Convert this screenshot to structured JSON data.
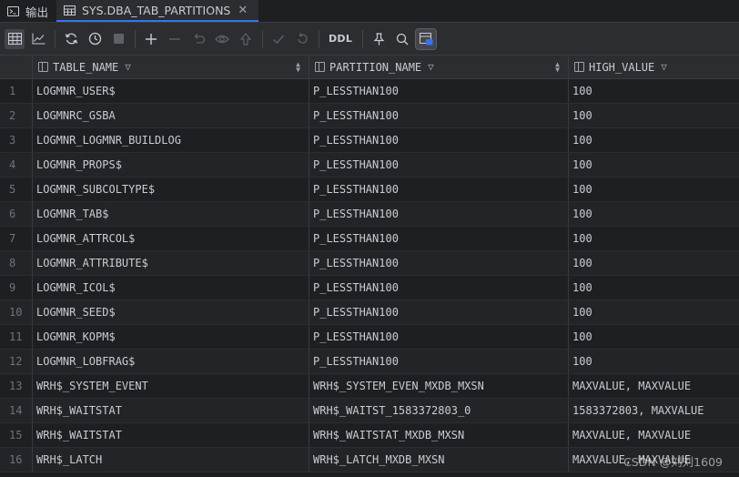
{
  "tabs": [
    {
      "label": "输出",
      "icon": "console-icon"
    },
    {
      "label": "SYS.DBA_TAB_PARTITIONS",
      "icon": "table-icon"
    }
  ],
  "toolbar": {
    "ddl_label": "DDL"
  },
  "columns": [
    "TABLE_NAME",
    "PARTITION_NAME",
    "HIGH_VALUE"
  ],
  "rows": [
    {
      "n": "1",
      "table_name": "LOGMNR_USER$",
      "partition_name": "P_LESSTHAN100",
      "high_value": "100"
    },
    {
      "n": "2",
      "table_name": "LOGMNRC_GSBA",
      "partition_name": "P_LESSTHAN100",
      "high_value": "100"
    },
    {
      "n": "3",
      "table_name": "LOGMNR_LOGMNR_BUILDLOG",
      "partition_name": "P_LESSTHAN100",
      "high_value": "100"
    },
    {
      "n": "4",
      "table_name": "LOGMNR_PROPS$",
      "partition_name": "P_LESSTHAN100",
      "high_value": "100"
    },
    {
      "n": "5",
      "table_name": "LOGMNR_SUBCOLTYPE$",
      "partition_name": "P_LESSTHAN100",
      "high_value": "100"
    },
    {
      "n": "6",
      "table_name": "LOGMNR_TAB$",
      "partition_name": "P_LESSTHAN100",
      "high_value": "100"
    },
    {
      "n": "7",
      "table_name": "LOGMNR_ATTRCOL$",
      "partition_name": "P_LESSTHAN100",
      "high_value": "100"
    },
    {
      "n": "8",
      "table_name": "LOGMNR_ATTRIBUTE$",
      "partition_name": "P_LESSTHAN100",
      "high_value": "100"
    },
    {
      "n": "9",
      "table_name": "LOGMNR_ICOL$",
      "partition_name": "P_LESSTHAN100",
      "high_value": "100"
    },
    {
      "n": "10",
      "table_name": "LOGMNR_SEED$",
      "partition_name": "P_LESSTHAN100",
      "high_value": "100"
    },
    {
      "n": "11",
      "table_name": "LOGMNR_KOPM$",
      "partition_name": "P_LESSTHAN100",
      "high_value": "100"
    },
    {
      "n": "12",
      "table_name": "LOGMNR_LOBFRAG$",
      "partition_name": "P_LESSTHAN100",
      "high_value": "100"
    },
    {
      "n": "13",
      "table_name": "WRH$_SYSTEM_EVENT",
      "partition_name": "WRH$_SYSTEM_EVEN_MXDB_MXSN",
      "high_value": "MAXVALUE, MAXVALUE"
    },
    {
      "n": "14",
      "table_name": "WRH$_WAITSTAT",
      "partition_name": "WRH$_WAITST_1583372803_0",
      "high_value": "1583372803, MAXVALUE"
    },
    {
      "n": "15",
      "table_name": "WRH$_WAITSTAT",
      "partition_name": "WRH$_WAITSTAT_MXDB_MXSN",
      "high_value": "MAXVALUE, MAXVALUE"
    },
    {
      "n": "16",
      "table_name": "WRH$_LATCH",
      "partition_name": "WRH$_LATCH_MXDB_MXSN",
      "high_value": "MAXVALUE, MAXVALUE"
    }
  ],
  "watermark": "CSDN @刘刘1609"
}
